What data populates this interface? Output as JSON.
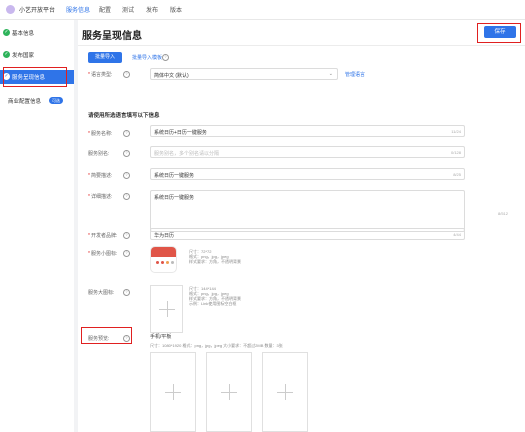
{
  "topbar": {
    "app_title": "小艺开放平台",
    "nav": [
      "服务信息",
      "配置",
      "测试",
      "发布",
      "版本"
    ]
  },
  "sidebar": {
    "items": [
      {
        "label": "基本信息"
      },
      {
        "label": "发布国家"
      },
      {
        "label": "服务呈现信息"
      },
      {
        "label": "商业配置信息",
        "badge": "可选"
      }
    ]
  },
  "main": {
    "title": "服务呈现信息",
    "save_label": "保存",
    "tabs": {
      "active": "批量导入",
      "template_link": "批量导入模板"
    },
    "language": {
      "label": "语言类型:",
      "value": "简体中文 (默认)",
      "manage_link": "管理语言"
    },
    "section_heading": "请使用所选语言填写以下信息",
    "service_name": {
      "label": "服务名称:",
      "value": "系统日历+日历一键服务",
      "count": "11/24"
    },
    "service_alias": {
      "label": "服务别名:",
      "placeholder": "服务别名，多个别名请以分隔",
      "count": "0/128"
    },
    "brief": {
      "label": "简要描述:",
      "value": "系统日历一键服务",
      "count": "8/25"
    },
    "detail": {
      "label": "详细描述:",
      "value": "系统日历一键服务",
      "count": "8/512"
    },
    "developer": {
      "label": "开发者品牌:",
      "value": "华为日历",
      "count": "4/44"
    },
    "small_icon": {
      "label": "服务小图标:",
      "spec": [
        "尺寸：72*72",
        "格式：png，jpg，jpeg",
        "样式要求：方角，不透明背景"
      ]
    },
    "large_icon": {
      "label": "服务大图标:",
      "spec": [
        "尺寸：144*144",
        "格式：png，jpg，jpeg",
        "样式要求：方角，不透明背景",
        "示例：Link使用图标空白框"
      ]
    },
    "preview": {
      "label": "服务预览:",
      "device": "手机/平板",
      "spec": "尺寸：1080*1920   格式：png，jpg，jpeg   大小要求：不超过2MB   数量：3张"
    }
  }
}
